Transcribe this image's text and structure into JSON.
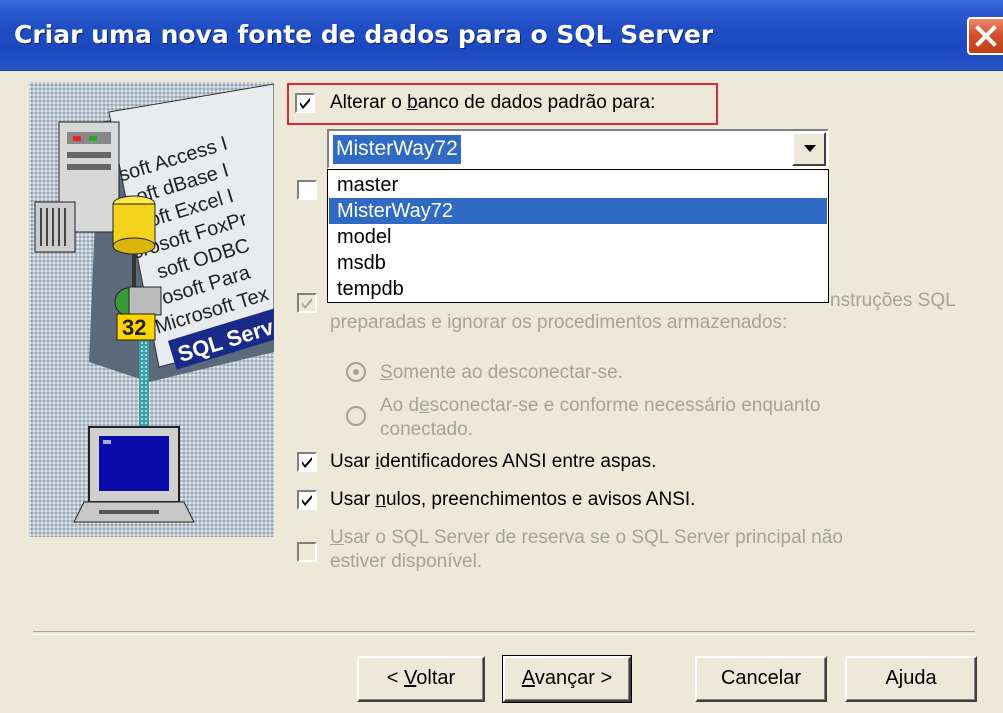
{
  "window": {
    "title": "Criar uma nova fonte de dados para o SQL Server",
    "close_icon": "close-icon"
  },
  "illustration": {
    "driver_list": [
      "soft Access I",
      "oft dBase I",
      "soft Excel I",
      "crosoft FoxPr",
      "soft ODBC",
      "osoft Para",
      "Microsoft Tex",
      "SQL Serv"
    ],
    "badge": "32"
  },
  "options": {
    "change_default_db": {
      "checked": true,
      "label_before": "Alterar o ",
      "label_accel": "b",
      "label_after": "anco de dados padrão para:"
    },
    "database_combo": {
      "selected": "MisterWay72",
      "options": [
        "master",
        "MisterWay72",
        "model",
        "msdb",
        "tempdb"
      ]
    },
    "attach_db_checkbox": {
      "checked": false
    },
    "temp_procs": {
      "checked": true,
      "enabled": false,
      "label_line1_tail": "nstruções SQL",
      "label_line2": "preparadas e ignorar os procedimentos armazenados:"
    },
    "drop_on_disconnect": {
      "selected": true,
      "label_before": "",
      "label_accel": "S",
      "label_after": "omente ao desconectar-se."
    },
    "drop_on_disconnect_and_needed": {
      "selected": false,
      "label_line1_before": "Ao d",
      "label_line1_accel": "e",
      "label_line1_after": "sconectar-se e conforme necessário enquanto",
      "label_line2": "conectado."
    },
    "ansi_quoted": {
      "checked": true,
      "label_before": "Usar ",
      "label_accel": "i",
      "label_after": "dentificadores ANSI entre aspas."
    },
    "ansi_nulls": {
      "checked": true,
      "label_before": "Usar ",
      "label_accel": "n",
      "label_after": "ulos, preenchimentos e avisos ANSI."
    },
    "failover": {
      "checked": false,
      "enabled": false,
      "label_line1_before": "",
      "label_line1_accel": "U",
      "label_line1_after": "sar o SQL Server de reserva se o SQL Server principal não",
      "label_line2": "estiver disponível."
    }
  },
  "buttons": {
    "back": {
      "prefix": "< ",
      "accel": "V",
      "rest": "oltar"
    },
    "next": {
      "accel": "A",
      "rest": "vançar >"
    },
    "cancel": "Cancelar",
    "help": "Ajuda"
  }
}
